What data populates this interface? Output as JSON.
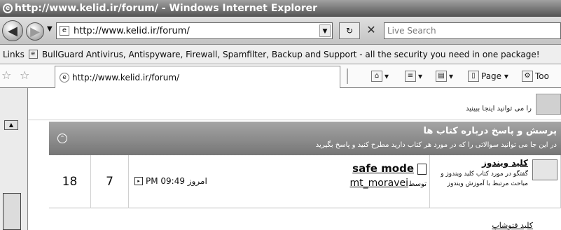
{
  "window": {
    "title": "http://www.kelid.ir/forum/ - Windows Internet Explorer"
  },
  "address": {
    "url": "http://www.kelid.ir/forum/",
    "search_placeholder": "Live Search"
  },
  "links": {
    "label": "Links",
    "item": "BullGuard Antivirus, Antispyware, Firewall, Spamfilter, Backup and Support - all the security you need in one package!"
  },
  "tab": {
    "label": "http://www.kelid.ir/forum/"
  },
  "commands": {
    "page": "Page",
    "tools": "Too"
  },
  "content": {
    "top_text": "را می توانید اینجا ببینید",
    "category": {
      "title": "پرسش و پاسخ درباره کتاب ها",
      "description": "در این جا می توانید سوالاتی را که در مورد هر کتاب دارید مطرح کنید و پاسخ بگیرید"
    },
    "forum_row": {
      "posts": "18",
      "threads": "7",
      "last_time": "PM 09:49",
      "last_day": "امروز",
      "last_thread": "safe mode",
      "by_label": "توسط",
      "last_user": "mt_moravei",
      "forum_title": "کلید ویندوز",
      "forum_desc": "گفتگو در مورد کتاب کلید ویندوز و مباحث مرتبط با آموزش ویندوز"
    },
    "next_forum": "کلید فتوشاپ"
  }
}
